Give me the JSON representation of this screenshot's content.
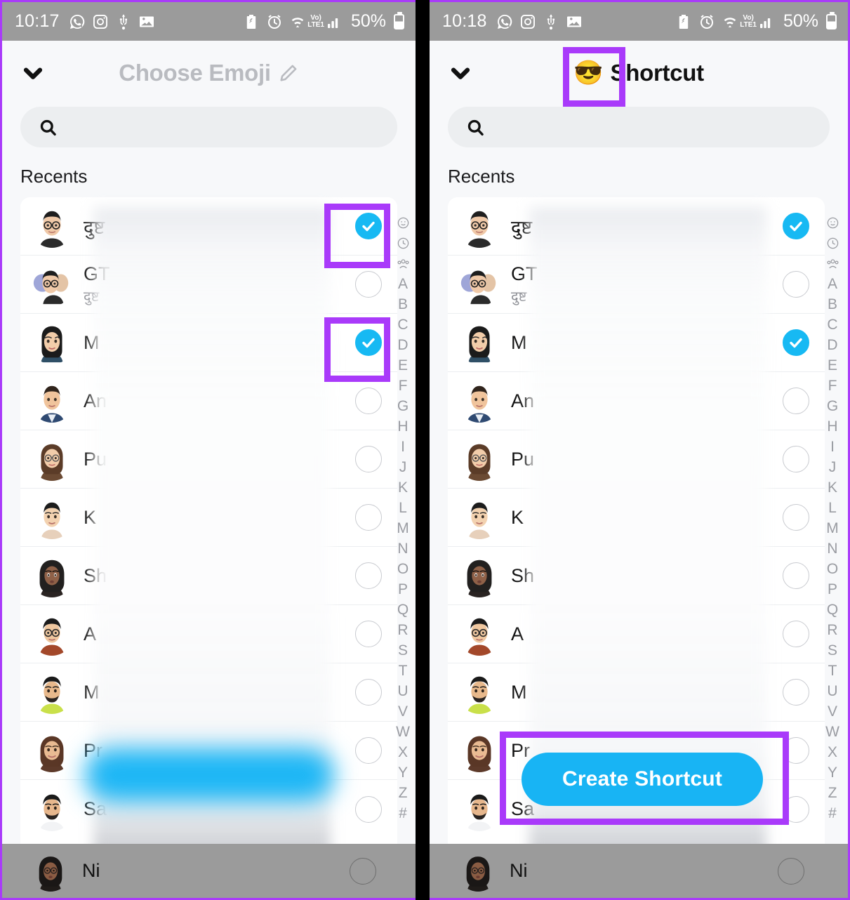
{
  "highlight_color": "#a93afa",
  "accent_blue": "#18b4f4",
  "panels": [
    {
      "id": "left",
      "statusbar": {
        "time": "10:17",
        "left_icons": [
          "whatsapp-icon",
          "instagram-icon",
          "usb-icon",
          "gallery-icon"
        ],
        "right_icons": [
          "battery-saver-icon",
          "alarm-icon",
          "wifi-icon"
        ],
        "network_label_top": "Vo)",
        "network_label_bottom": "LTE1",
        "battery_percent": "50%"
      },
      "header": {
        "back_icon": "chevron-down-icon",
        "title": "Choose Emoji",
        "title_muted": true,
        "edit_icon": "pencil-icon",
        "emoji": ""
      },
      "search": {
        "value": "",
        "placeholder": "",
        "icon": "search-icon"
      },
      "section_label": "Recents",
      "rows": [
        {
          "name": "दुष्ट",
          "sub": "",
          "checked": true,
          "avatar": "man-glasses-black-tee"
        },
        {
          "name": "GT",
          "sub": "दुष्ट",
          "checked": false,
          "avatar": "group-two-people"
        },
        {
          "name": "M",
          "sub": "",
          "checked": true,
          "avatar": "woman-long-black-hair"
        },
        {
          "name": "An",
          "sub": "",
          "checked": false,
          "avatar": "man-short-hair-blue-shirt"
        },
        {
          "name": "Pu",
          "sub": "",
          "checked": false,
          "avatar": "woman-glasses-wavy-hair"
        },
        {
          "name": "K",
          "sub": "",
          "checked": false,
          "avatar": "man-light-skin-short-hair"
        },
        {
          "name": "Sh",
          "sub": "",
          "checked": false,
          "avatar": "woman-dark-skin-curly"
        },
        {
          "name": "A",
          "sub": "",
          "checked": false,
          "avatar": "man-glasses-brown-tee"
        },
        {
          "name": "M",
          "sub": "",
          "checked": false,
          "avatar": "man-beard-green-shirt"
        },
        {
          "name": "Pr",
          "sub": "",
          "checked": false,
          "avatar": "woman-brown-wavy-hair"
        },
        {
          "name": "Sa",
          "sub": "",
          "checked": false,
          "avatar": "man-beard-white-shirt"
        }
      ],
      "bottom_row": {
        "name": "Ni",
        "checked": false,
        "avatar": "woman-glasses-dark-hair"
      },
      "alpha_index": [
        "smiley-icon",
        "clock-icon",
        "group-icon",
        "A",
        "B",
        "C",
        "D",
        "E",
        "F",
        "G",
        "H",
        "I",
        "J",
        "K",
        "L",
        "M",
        "N",
        "O",
        "P",
        "Q",
        "R",
        "S",
        "T",
        "U",
        "V",
        "W",
        "X",
        "Y",
        "Z",
        "#"
      ],
      "cta": null,
      "blurred_button": true
    },
    {
      "id": "right",
      "statusbar": {
        "time": "10:18",
        "left_icons": [
          "whatsapp-icon",
          "instagram-icon",
          "usb-icon",
          "gallery-icon"
        ],
        "right_icons": [
          "battery-saver-icon",
          "alarm-icon",
          "wifi-icon"
        ],
        "network_label_top": "Vo)",
        "network_label_bottom": "LTE1",
        "battery_percent": "50%"
      },
      "header": {
        "back_icon": "chevron-down-icon",
        "title": "Shortcut",
        "title_muted": false,
        "edit_icon": "",
        "emoji": "😎"
      },
      "search": {
        "value": "",
        "placeholder": "",
        "icon": "search-icon"
      },
      "section_label": "Recents",
      "rows": [
        {
          "name": "दुष्ट",
          "sub": "",
          "checked": true,
          "avatar": "man-glasses-black-tee"
        },
        {
          "name": "GT",
          "sub": "दुष्ट",
          "checked": false,
          "avatar": "group-two-people"
        },
        {
          "name": "M",
          "sub": "",
          "checked": true,
          "avatar": "woman-long-black-hair"
        },
        {
          "name": "An",
          "sub": "",
          "checked": false,
          "avatar": "man-short-hair-blue-shirt"
        },
        {
          "name": "Pu",
          "sub": "",
          "checked": false,
          "avatar": "woman-glasses-wavy-hair"
        },
        {
          "name": "K",
          "sub": "",
          "checked": false,
          "avatar": "man-light-skin-short-hair"
        },
        {
          "name": "Sh",
          "sub": "",
          "checked": false,
          "avatar": "woman-dark-skin-curly"
        },
        {
          "name": "A",
          "sub": "",
          "checked": false,
          "avatar": "man-glasses-brown-tee"
        },
        {
          "name": "M",
          "sub": "",
          "checked": false,
          "avatar": "man-beard-green-shirt"
        },
        {
          "name": "Pr",
          "sub": "",
          "checked": false,
          "avatar": "woman-brown-wavy-hair"
        },
        {
          "name": "Sa",
          "sub": "",
          "checked": false,
          "avatar": "man-beard-white-shirt"
        }
      ],
      "bottom_row": {
        "name": "Ni",
        "checked": false,
        "avatar": "woman-glasses-dark-hair"
      },
      "alpha_index": [
        "smiley-icon",
        "clock-icon",
        "group-icon",
        "A",
        "B",
        "C",
        "D",
        "E",
        "F",
        "G",
        "H",
        "I",
        "J",
        "K",
        "L",
        "M",
        "N",
        "O",
        "P",
        "Q",
        "R",
        "S",
        "T",
        "U",
        "V",
        "W",
        "X",
        "Y",
        "Z",
        "#"
      ],
      "cta": "Create Shortcut",
      "blurred_button": false
    }
  ]
}
